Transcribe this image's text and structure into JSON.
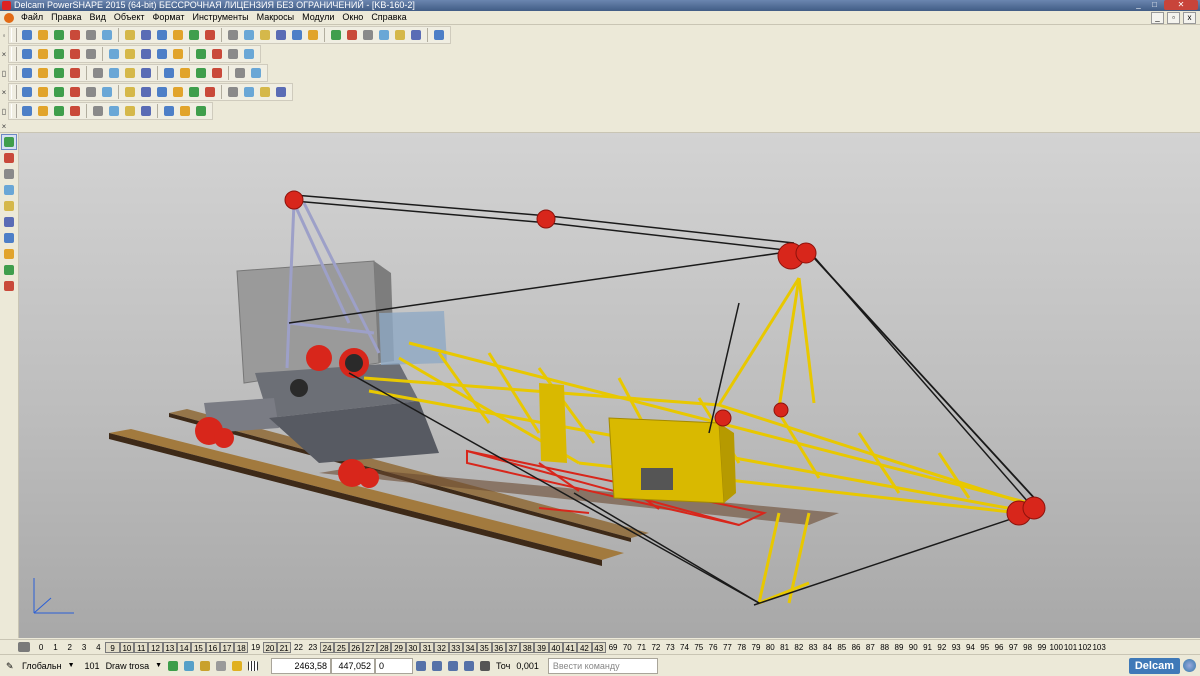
{
  "window": {
    "title": "Delcam PowerSHAPE 2015 (64-bit) БЕССРОЧНАЯ ЛИЦЕНЗИЯ БЕЗ ОГРАНИЧЕНИЙ - [KB-160-2]",
    "controls": {
      "minimize": "_",
      "maximize": "□",
      "close": "✕"
    }
  },
  "menu": {
    "items": [
      "Файл",
      "Правка",
      "Вид",
      "Объект",
      "Формат",
      "Инструменты",
      "Макросы",
      "Модули",
      "Окно",
      "Справка"
    ]
  },
  "toolbars": {
    "row1": [
      "new-file",
      "open-file",
      "save",
      "save-as",
      "print",
      "print-preview",
      "cut",
      "copy",
      "paste",
      "properties",
      "delete",
      "undo",
      "redo",
      "select-all",
      "workplane",
      "wireframe",
      "point",
      "line",
      "arc",
      "curve",
      "text",
      "dimension",
      "surface-shade",
      "solid-shade",
      "view-spin"
    ],
    "row2": [
      "surface-plane",
      "surface-extrude",
      "surface-revolve",
      "surface-block",
      "surface-drive",
      "surface-fillet",
      "zoom-in",
      "zoom-out",
      "zoom-box",
      "view-fit",
      "shade",
      "wireframe-toggle",
      "render",
      "lights"
    ],
    "row3": [
      "solid-new",
      "solid-block",
      "solid-cylinder",
      "solid-cone",
      "solid-sphere",
      "solid-torus",
      "solid-extrude",
      "solid-revolve",
      "solid-sweep",
      "solid-boolean",
      "solid-fillet",
      "solid-chamfer",
      "solid-shell",
      "solid-draft"
    ],
    "row4": [
      "assembly-new",
      "assembly-insert",
      "component-move",
      "component-rotate",
      "component-copy",
      "component-mirror",
      "component-constrain",
      "component-replace",
      "assembly-explode",
      "assembly-tree",
      "assembly-bom",
      "assembly-check",
      "assembly-clash",
      "assembly-section",
      "assembly-settings",
      "assembly-export"
    ],
    "row5": [
      "feature-hole",
      "feature-cut",
      "feature-boss",
      "feature-pattern",
      "feature-mirror",
      "feature-thread",
      "feature-rib",
      "feature-web",
      "feature-edit",
      "feature-tree",
      "feature-suppress"
    ]
  },
  "left_toolbar": [
    "select-icon",
    "multi-select-icon",
    "general-edit-icon",
    "surface-icon",
    "solid-icon",
    "curve-icon",
    "text-icon",
    "dimension-icon",
    "electrode-icon",
    "assembly-icon"
  ],
  "levels": {
    "items": [
      "0",
      "1",
      "2",
      "3",
      "4",
      "9",
      "10",
      "11",
      "12",
      "13",
      "14",
      "15",
      "16",
      "17",
      "18",
      "19",
      "20",
      "21",
      "22",
      "23",
      "24",
      "25",
      "26",
      "27",
      "28",
      "29",
      "30",
      "31",
      "32",
      "33",
      "34",
      "35",
      "36",
      "37",
      "38",
      "39",
      "40",
      "41",
      "42",
      "43",
      "69",
      "70",
      "71",
      "72",
      "73",
      "74",
      "75",
      "76",
      "77",
      "78",
      "79",
      "80",
      "81",
      "82",
      "83",
      "84",
      "85",
      "86",
      "87",
      "88",
      "89",
      "90",
      "91",
      "92",
      "93",
      "94",
      "95",
      "96",
      "97",
      "98",
      "99",
      "100",
      "101",
      "102",
      "103"
    ],
    "active": [
      "9",
      "10",
      "11",
      "12",
      "13",
      "14",
      "15",
      "16",
      "17",
      "18",
      "20",
      "21",
      "24",
      "25",
      "26",
      "27",
      "28",
      "29",
      "30",
      "31",
      "32",
      "33",
      "34",
      "35",
      "36",
      "37",
      "38",
      "39",
      "40",
      "41",
      "42",
      "43"
    ]
  },
  "status": {
    "workplane": "Глобальн",
    "level_number": "101",
    "level_name": "Draw trosa",
    "coord_x": "2463,58",
    "coord_y": "447,052",
    "coord_z": "0",
    "tolerance_label": "Точ",
    "tolerance_value": "0,001",
    "command_placeholder": "Ввести команду",
    "brand": "Delcam"
  },
  "colors": {
    "boom_yellow": "#e8c800",
    "sheave_red": "#d8261b",
    "track_brown": "#6a4a30",
    "viewport_bg": "#c4c4c4"
  }
}
